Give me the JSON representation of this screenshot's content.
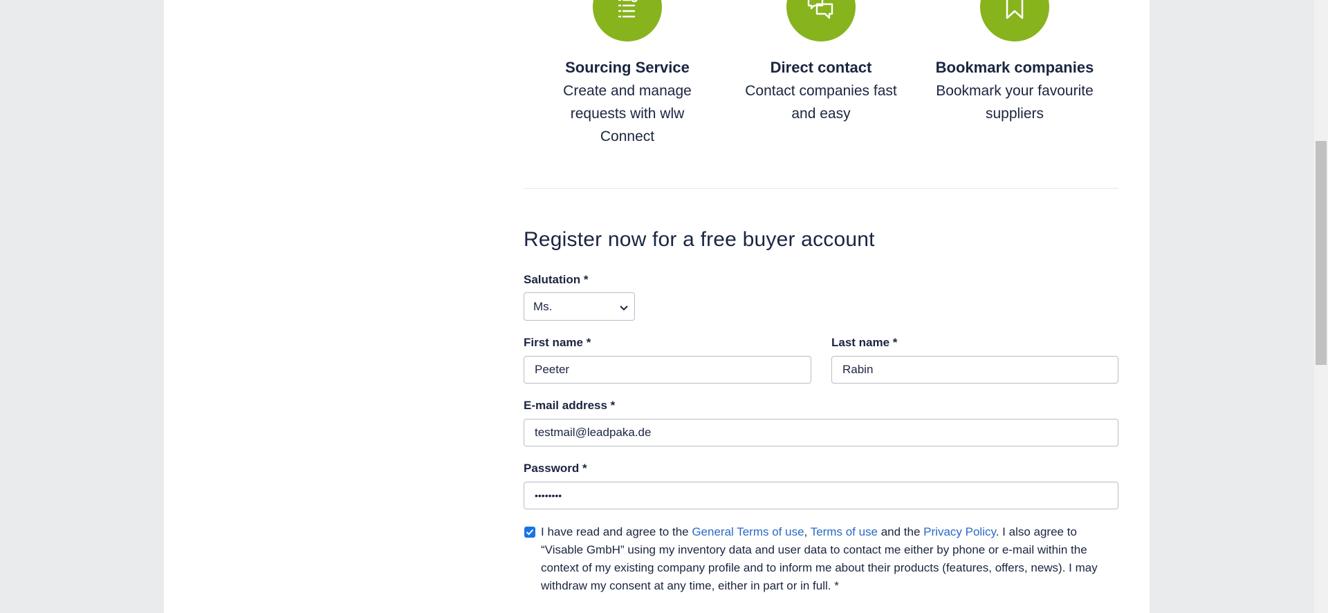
{
  "features": [
    {
      "icon": "list-search-icon",
      "title": "Sourcing Service",
      "desc_lines": [
        "Create and manage",
        "requests with wlw",
        "Connect"
      ]
    },
    {
      "icon": "chat-bubbles-icon",
      "title": "Direct contact",
      "desc_lines": [
        "Contact companies fast",
        "and easy"
      ]
    },
    {
      "icon": "bookmark-icon",
      "title": "Bookmark companies",
      "desc_lines": [
        "Bookmark your favourite",
        "suppliers"
      ]
    }
  ],
  "form": {
    "heading": "Register now for a free buyer account",
    "salutation": {
      "label": "Salutation *",
      "value": "Ms."
    },
    "first_name": {
      "label": "First name *",
      "value": "Peeter"
    },
    "last_name": {
      "label": "Last name *",
      "value": "Rabin"
    },
    "email": {
      "label": "E-mail address *",
      "value": "testmail@leadpaka.de"
    },
    "password": {
      "label": "Password *",
      "value": "••••••••"
    },
    "consent": {
      "checked": true,
      "text_1": "I have read and agree to the ",
      "link_general_terms": "General Terms of use",
      "sep_1": ", ",
      "link_terms": "Terms of use",
      "text_2": " and the ",
      "link_privacy": "Privacy Policy",
      "text_3": ". I also agree to “Visable GmbH” using my inventory data and user data to contact me either by phone or e-mail within the context of my existing company profile and to inform me about their products (features, offers, news). I may withdraw my consent at any time, either in part or in full. *"
    }
  },
  "colors": {
    "accent_green": "#87b31c",
    "link_blue": "#2a69c7",
    "text_dark": "#1b2541"
  }
}
